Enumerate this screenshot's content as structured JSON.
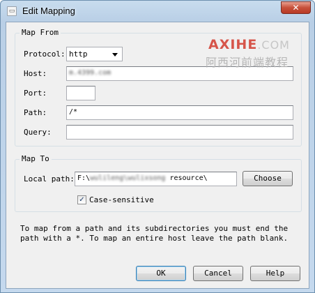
{
  "window": {
    "title": "Edit Mapping",
    "app_icon": "document-icon",
    "close_glyph": "✕"
  },
  "watermark": {
    "brand": "AXIHE",
    "domain": ".COM",
    "subtitle": "阿西河前端教程"
  },
  "map_from": {
    "legend": "Map From",
    "protocol": {
      "label": "Protocol:",
      "value": "http"
    },
    "host": {
      "label": "Host:",
      "value": "m.4399.com"
    },
    "port": {
      "label": "Port:",
      "value": ""
    },
    "path": {
      "label": "Path:",
      "value": "/*"
    },
    "query": {
      "label": "Query:",
      "value": ""
    }
  },
  "map_to": {
    "legend": "Map To",
    "local_path": {
      "label": "Local path:",
      "value_prefix": "F:\\",
      "value_obscured": "wulileng\\wulixsong",
      "value_suffix": " resource\\"
    },
    "choose_button": "Choose",
    "case_sensitive": {
      "label": "Case-sensitive",
      "checked": true,
      "check_glyph": "✓"
    }
  },
  "hint": "To map from a path and its subdirectories you must end the path with a *. To map an entire host leave the path blank.",
  "buttons": {
    "ok": "OK",
    "cancel": "Cancel",
    "help": "Help"
  },
  "colors": {
    "default_button_border": "#3c7fb1",
    "watermark_red": "#d23a2e"
  }
}
